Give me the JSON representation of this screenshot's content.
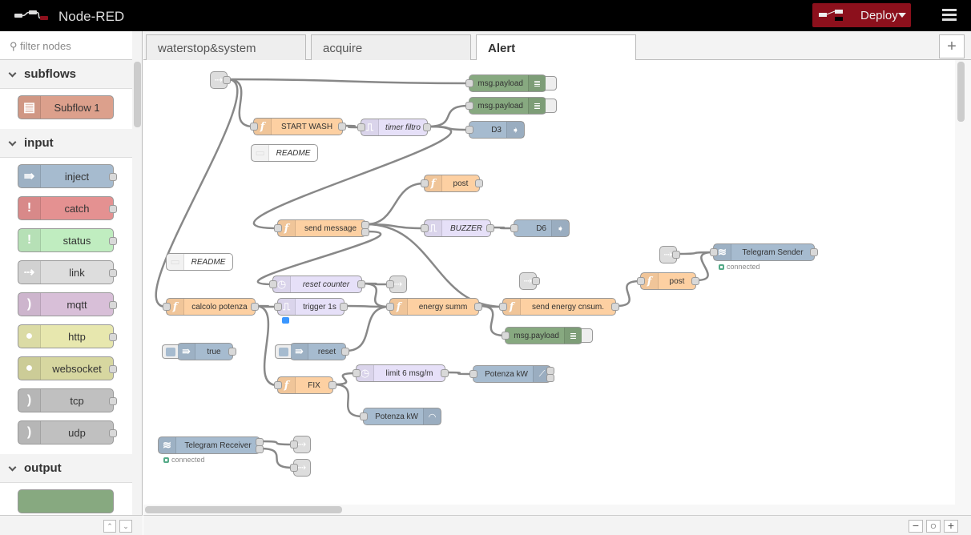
{
  "header": {
    "title": "Node-RED",
    "deploy_label": "Deploy",
    "brand_color": "#8c101c"
  },
  "palette": {
    "filter_placeholder": "filter nodes",
    "categories": [
      {
        "label": "subflows",
        "nodes": [
          {
            "label": "Subflow 1",
            "color": "#dca08c",
            "icon": "subflow-icon"
          }
        ]
      },
      {
        "label": "input",
        "nodes": [
          {
            "label": "inject",
            "color": "#a6bbcf",
            "icon": "inject-icon",
            "glyph": "⇛"
          },
          {
            "label": "catch",
            "color": "#e49191",
            "icon": "alert-icon",
            "glyph": "!"
          },
          {
            "label": "status",
            "color": "#c0edc0",
            "icon": "alert-icon",
            "glyph": "!"
          },
          {
            "label": "link",
            "color": "#dddddd",
            "icon": "link-icon",
            "glyph": "⇢"
          },
          {
            "label": "mqtt",
            "color": "#d8bfd8",
            "icon": "bridge-icon",
            "glyph": ")"
          },
          {
            "label": "http",
            "color": "#e7e7ae",
            "icon": "globe-icon",
            "glyph": "●"
          },
          {
            "label": "websocket",
            "color": "#d7d7a0",
            "icon": "globe-icon",
            "glyph": "●"
          },
          {
            "label": "tcp",
            "color": "#c0c0c0",
            "icon": "bridge-icon",
            "glyph": ")"
          },
          {
            "label": "udp",
            "color": "#c0c0c0",
            "icon": "bridge-icon",
            "glyph": ")"
          }
        ]
      },
      {
        "label": "output",
        "nodes": []
      }
    ]
  },
  "tabs": [
    {
      "label": "waterstop&system"
    },
    {
      "label": "acquire"
    },
    {
      "label": "Alert",
      "active": true
    }
  ],
  "flow": {
    "nodes": {
      "link1": {
        "label": ""
      },
      "dbg1": {
        "label": "msg.payload"
      },
      "dbg2": {
        "label": "msg.payload"
      },
      "startwash": {
        "label": "START WASH"
      },
      "timerfiltro": {
        "label": "timer filtro"
      },
      "d3": {
        "label": "D3"
      },
      "readme1": {
        "label": "README"
      },
      "post1": {
        "label": "post"
      },
      "sendmsg": {
        "label": "send message"
      },
      "buzzer": {
        "label": "BUZZER"
      },
      "d6": {
        "label": "D6"
      },
      "readme2": {
        "label": "README"
      },
      "tgsender": {
        "label": "Telegram Sender",
        "status": "connected"
      },
      "link2": {
        "label": ""
      },
      "link3": {
        "label": ""
      },
      "resetcounter": {
        "label": "reset counter"
      },
      "linkout1": {
        "label": ""
      },
      "post2": {
        "label": "post"
      },
      "calcolo": {
        "label": "calcolo potenza"
      },
      "trigger1s": {
        "label": "trigger 1s"
      },
      "energysumm": {
        "label": "energy summ"
      },
      "sendenergy": {
        "label": "send energy cnsum."
      },
      "dbg3": {
        "label": "msg.payload"
      },
      "injtrue": {
        "label": "true"
      },
      "injreset": {
        "label": "reset"
      },
      "limit": {
        "label": "limit 6 msg/m"
      },
      "chart": {
        "label": "Potenza kW"
      },
      "fix": {
        "label": "FIX"
      },
      "gauge": {
        "label": "Potenza kW"
      },
      "tgrecv": {
        "label": "Telegram Receiver",
        "status": "connected"
      },
      "link4": {
        "label": ""
      },
      "link5": {
        "label": ""
      }
    },
    "wires": [
      [
        "link1",
        0,
        "dbg1"
      ],
      [
        "link1",
        0,
        "startwash"
      ],
      [
        "link1",
        0,
        "calcolo"
      ],
      [
        "startwash",
        0,
        "timerfiltro"
      ],
      [
        "timerfiltro",
        0,
        "dbg2"
      ],
      [
        "timerfiltro",
        0,
        "d3"
      ],
      [
        "timerfiltro",
        0,
        "sendmsg"
      ],
      [
        "sendmsg",
        0,
        "post1"
      ],
      [
        "sendmsg",
        0,
        "buzzer"
      ],
      [
        "sendmsg",
        0,
        "sendenergy"
      ],
      [
        "sendmsg",
        1,
        "resetcounter"
      ],
      [
        "buzzer",
        0,
        "d6"
      ],
      [
        "link2",
        0,
        "tgsender"
      ],
      [
        "post2",
        0,
        "tgsender"
      ],
      [
        "sendenergy",
        0,
        "post2"
      ],
      [
        "resetcounter",
        0,
        "linkout1"
      ],
      [
        "resetcounter",
        0,
        "energysumm"
      ],
      [
        "calcolo",
        0,
        "trigger1s"
      ],
      [
        "calcolo",
        0,
        "fix"
      ],
      [
        "trigger1s",
        0,
        "energysumm"
      ],
      [
        "injreset",
        0,
        "energysumm"
      ],
      [
        "energysumm",
        0,
        "sendenergy"
      ],
      [
        "energysumm",
        0,
        "dbg3"
      ],
      [
        "fix",
        0,
        "limit"
      ],
      [
        "fix",
        0,
        "gauge"
      ],
      [
        "limit",
        0,
        "chart"
      ],
      [
        "tgrecv",
        0,
        "link4"
      ],
      [
        "tgrecv",
        1,
        "link5"
      ]
    ]
  },
  "colors": {
    "function": "#fdd0a2",
    "trigger": "#e6e0f8",
    "debug": "#87a980",
    "dashboard": "#a6bbcf",
    "link": "#dddddd"
  }
}
